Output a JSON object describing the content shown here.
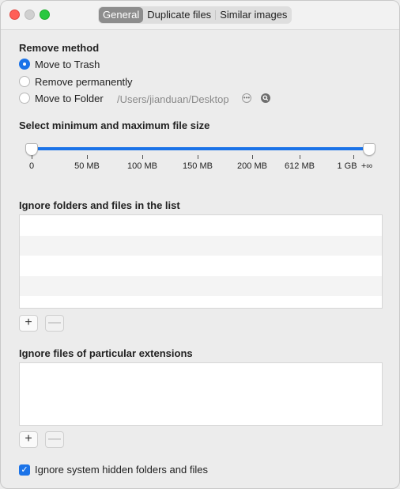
{
  "tabs": [
    {
      "label": "General",
      "active": true
    },
    {
      "label": "Duplicate files",
      "active": false
    },
    {
      "label": "Similar images",
      "active": false
    }
  ],
  "remove_method": {
    "title": "Remove method",
    "options": [
      {
        "label": "Move to Trash",
        "selected": true
      },
      {
        "label": "Remove permanently",
        "selected": false
      },
      {
        "label": "Move to Folder",
        "selected": false
      }
    ],
    "folder_path": "/Users/jianduan/Desktop",
    "more_icon": "ellipsis-icon",
    "search_icon": "magnifier-icon"
  },
  "file_size": {
    "title": "Select minimum and maximum file size",
    "ticks": [
      "0",
      "50 MB",
      "100 MB",
      "150 MB",
      "200 MB",
      "612 MB",
      "1 GB",
      "+∞"
    ],
    "min_value": "0",
    "max_value": "+∞"
  },
  "ignore_list": {
    "title": "Ignore folders and files in the list",
    "add_label": "+",
    "remove_label": "—"
  },
  "ignore_ext": {
    "title": "Ignore files of particular extensions",
    "add_label": "+",
    "remove_label": "—"
  },
  "hidden": {
    "label": "Ignore system hidden folders and files",
    "checked": true
  },
  "colors": {
    "accent": "#1b73e8",
    "close": "#ff5f57",
    "maximize": "#28c840"
  }
}
